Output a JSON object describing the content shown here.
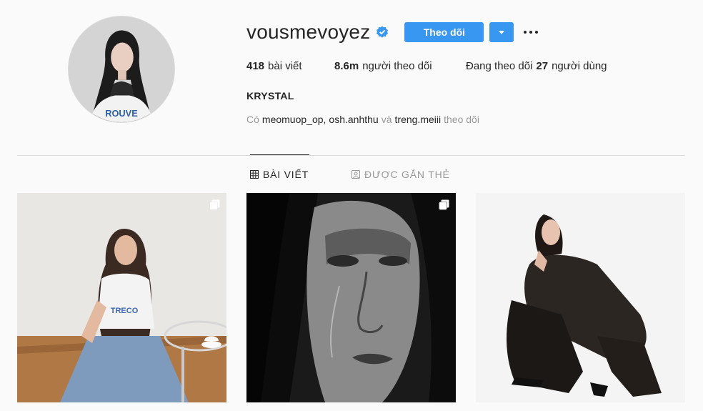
{
  "profile": {
    "username": "vousmevoyez",
    "verified": true,
    "follow_label": "Theo dõi",
    "full_name": "KRYSTAL"
  },
  "stats": {
    "posts_count": "418",
    "posts_label": "bài viết",
    "followers_count": "8.6m",
    "followers_label": "người theo dõi",
    "following_prefix": "Đang theo dõi",
    "following_count": "27",
    "following_suffix": "người dùng"
  },
  "followed_by": {
    "prefix": "Có",
    "user1": "meomuop_op,",
    "user2": "osh.anhthu",
    "conj": "và",
    "user3": "treng.meiii",
    "suffix": "theo dõi"
  },
  "tabs": [
    {
      "label": "BÀI VIẾT",
      "icon": "grid-icon",
      "active": true
    },
    {
      "label": "ĐƯỢC GẮN THẺ",
      "icon": "tagged-icon",
      "active": false
    }
  ],
  "colors": {
    "accent": "#3897f0",
    "text": "#262626",
    "muted": "#999999",
    "background": "#fafafa",
    "divider": "#dbdbdb"
  }
}
